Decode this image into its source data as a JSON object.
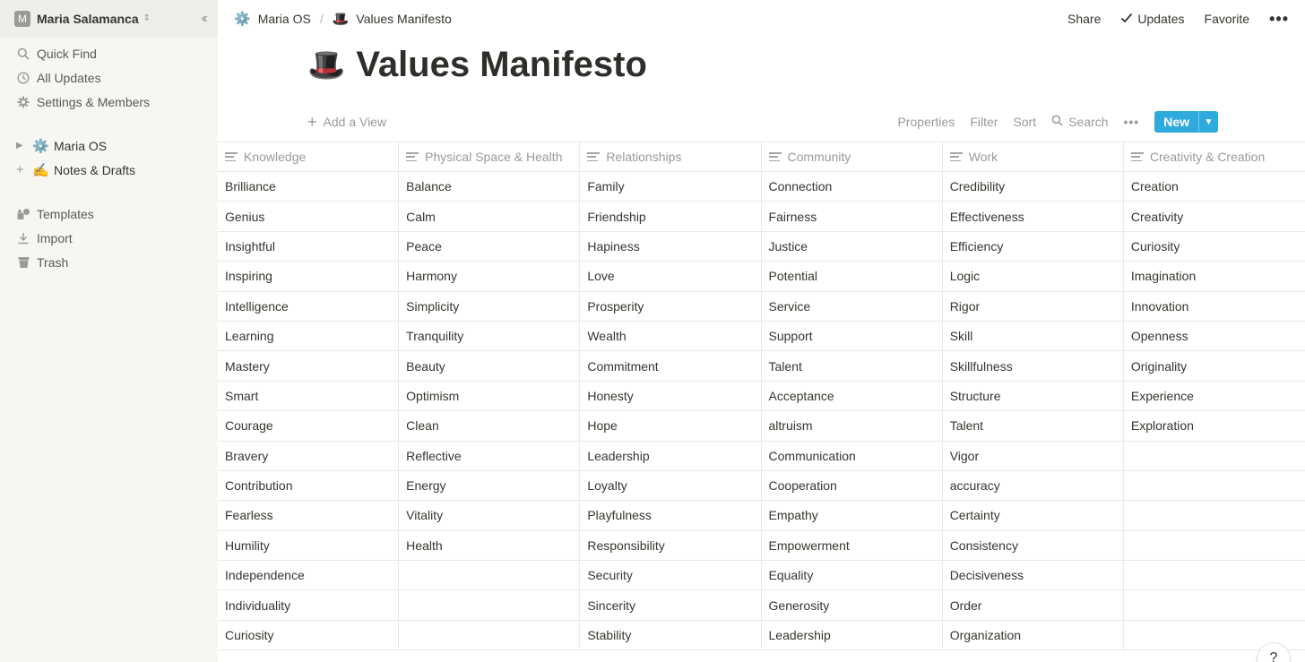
{
  "sidebar": {
    "workspace": {
      "avatar": "M",
      "name": "Maria Salamanca"
    },
    "nav": [
      {
        "label": "Quick Find",
        "icon": "search-icon"
      },
      {
        "label": "All Updates",
        "icon": "clock-icon"
      },
      {
        "label": "Settings & Members",
        "icon": "gear-icon"
      }
    ],
    "pages": [
      {
        "emoji": "⚙️",
        "label": "Maria OS"
      },
      {
        "emoji": "✍️",
        "label": "Notes & Drafts"
      }
    ],
    "footer": [
      {
        "label": "Templates",
        "icon": "templates-icon"
      },
      {
        "label": "Import",
        "icon": "import-icon"
      },
      {
        "label": "Trash",
        "icon": "trash-icon"
      }
    ]
  },
  "topbar": {
    "breadcrumb": [
      {
        "emoji": "⚙️",
        "label": "Maria OS"
      },
      {
        "emoji": "🎩",
        "label": "Values Manifesto"
      }
    ],
    "share": "Share",
    "updates": "Updates",
    "favorite": "Favorite",
    "more": "•••"
  },
  "page": {
    "emoji": "🎩",
    "title": "Values Manifesto"
  },
  "viewbar": {
    "add_view": "Add a View",
    "properties": "Properties",
    "filter": "Filter",
    "sort": "Sort",
    "search": "Search",
    "more": "•••",
    "new": "New"
  },
  "table": {
    "columns": [
      "Knowledge",
      "Physical Space & Health",
      "Relationships",
      "Community",
      "Work",
      "Creativity & Creation"
    ],
    "rows": [
      [
        "Brilliance",
        "Balance",
        "Family",
        "Connection",
        "Credibility",
        "Creation"
      ],
      [
        "Genius",
        "Calm",
        "Friendship",
        "Fairness",
        "Effectiveness",
        "Creativity"
      ],
      [
        "Insightful",
        "Peace",
        "Hapiness",
        "Justice",
        "Efficiency",
        "Curiosity"
      ],
      [
        "Inspiring",
        "Harmony",
        "Love",
        "Potential",
        "Logic",
        "Imagination"
      ],
      [
        "Intelligence",
        "Simplicity",
        "Prosperity",
        "Service",
        "Rigor",
        "Innovation"
      ],
      [
        "Learning",
        "Tranquility",
        "Wealth",
        "Support",
        "Skill",
        "Openness"
      ],
      [
        "Mastery",
        "Beauty",
        "Commitment",
        "Talent",
        "Skillfulness",
        "Originality"
      ],
      [
        "Smart",
        "Optimism",
        "Honesty",
        "Acceptance",
        "Structure",
        "Experience"
      ],
      [
        "Courage",
        "Clean",
        "Hope",
        "altruism",
        "Talent",
        "Exploration"
      ],
      [
        "Bravery",
        "Reflective",
        "Leadership",
        "Communication",
        "Vigor",
        ""
      ],
      [
        "Contribution",
        "Energy",
        "Loyalty",
        "Cooperation",
        "accuracy",
        ""
      ],
      [
        "Fearless",
        "Vitality",
        "Playfulness",
        "Empathy",
        "Certainty",
        ""
      ],
      [
        "Humility",
        "Health",
        "Responsibility",
        "Empowerment",
        "Consistency",
        ""
      ],
      [
        "Independence",
        "",
        "Security",
        "Equality",
        "Decisiveness",
        ""
      ],
      [
        "Individuality",
        "",
        "Sincerity",
        "Generosity",
        "Order",
        ""
      ],
      [
        "Curiosity",
        "",
        "Stability",
        "Leadership",
        "Organization",
        ""
      ]
    ]
  },
  "help": "?"
}
